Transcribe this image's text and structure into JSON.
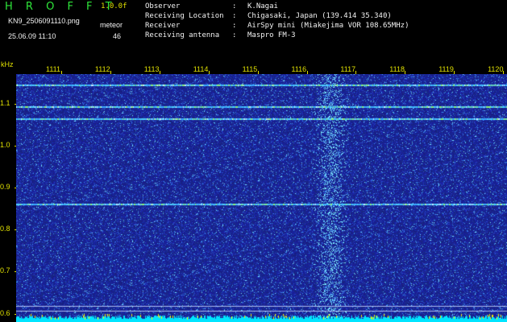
{
  "header": {
    "app_title": "H R O F F T",
    "version": "1.0.0f",
    "filename": "KN9_2506091110.png",
    "meteor_label": "meteor",
    "datetime": "25.06.09 11:10",
    "meteor_count": "46"
  },
  "info": [
    {
      "key": "Observer",
      "value": "K.Nagai"
    },
    {
      "key": "Receiving Location",
      "value": "Chigasaki, Japan (139.414 35.340)"
    },
    {
      "key": "Receiver",
      "value": "AirSpy mini (Miakejima VOR 108.65MHz)"
    },
    {
      "key": "Receiving antenna",
      "value": "Maspro FM-3"
    }
  ],
  "info_separator": ":",
  "colors": {
    "title": "#2ee63a",
    "axis": "#e0e000",
    "text": "#f2f2f2",
    "background": "#000000",
    "spectrogram_base": "#1a2a9a",
    "trace": "#39c8ff",
    "baseline": "#00e5ff"
  },
  "chart_data": {
    "type": "heatmap",
    "ylabel": "kHz",
    "x_ticks": [
      "1111",
      "1112",
      "1113",
      "1114",
      "1115",
      "1116",
      "1117",
      "1118",
      "1119",
      "1120"
    ],
    "y_ticks": [
      "1.1",
      "1.0",
      "0.9",
      "0.8",
      "0.7",
      "0.6"
    ],
    "ylim": [
      0.58,
      1.17
    ],
    "horizontal_traces_khz": [
      1.145,
      1.093,
      1.065,
      0.862,
      0.618,
      0.606
    ],
    "bright_column_x": "1116"
  }
}
